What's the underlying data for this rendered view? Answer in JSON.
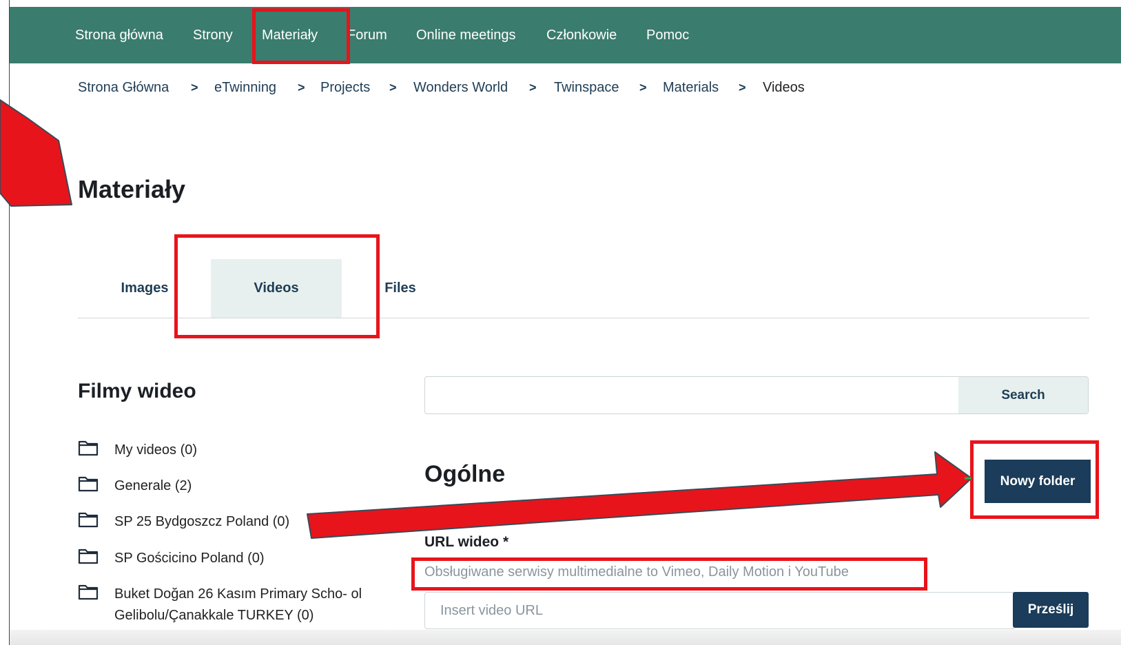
{
  "nav": {
    "items": [
      {
        "label": "Strona główna"
      },
      {
        "label": "Strony"
      },
      {
        "label": "Materiały"
      },
      {
        "label": "Forum"
      },
      {
        "label": "Online meetings"
      },
      {
        "label": "Członkowie"
      },
      {
        "label": "Pomoc"
      }
    ]
  },
  "breadcrumb": {
    "items": [
      "Strona Główna",
      "eTwinning",
      "Projects",
      "Wonders World",
      "Twinspace",
      "Materials",
      "Videos"
    ],
    "separator": ">"
  },
  "page": {
    "title": "Materiały"
  },
  "tabs": [
    {
      "label": "Images",
      "active": false
    },
    {
      "label": "Videos",
      "active": true
    },
    {
      "label": "Files",
      "active": false
    }
  ],
  "sidebar": {
    "title": "Filmy wideo",
    "folders": [
      {
        "label": "My videos (0)"
      },
      {
        "label": "Generale (2)"
      },
      {
        "label": "SP 25 Bydgoszcz Poland (0)"
      },
      {
        "label": "SP Gościcino Poland (0)"
      },
      {
        "label": "Buket Doğan 26 Kasım Primary Scho- ol Gelibolu/Çanakkale TURKEY (0)"
      }
    ],
    "folder_icon": "folder-icon"
  },
  "search": {
    "value": "",
    "button_label": "Search"
  },
  "general": {
    "title": "Ogólne",
    "new_folder_label": "Nowy folder",
    "url_label": "URL wideo *",
    "hint": "Obsługiwane serwisy multimedialne to Vimeo, Daily Motion i YouTube",
    "url_placeholder": "Insert video URL",
    "submit_label": "Prześlij"
  },
  "colors": {
    "topbar": "#3a7c6d",
    "primary_button": "#1b3c5a",
    "active_tab": "#e7f0ee",
    "annotation_red": "#e8141b"
  }
}
